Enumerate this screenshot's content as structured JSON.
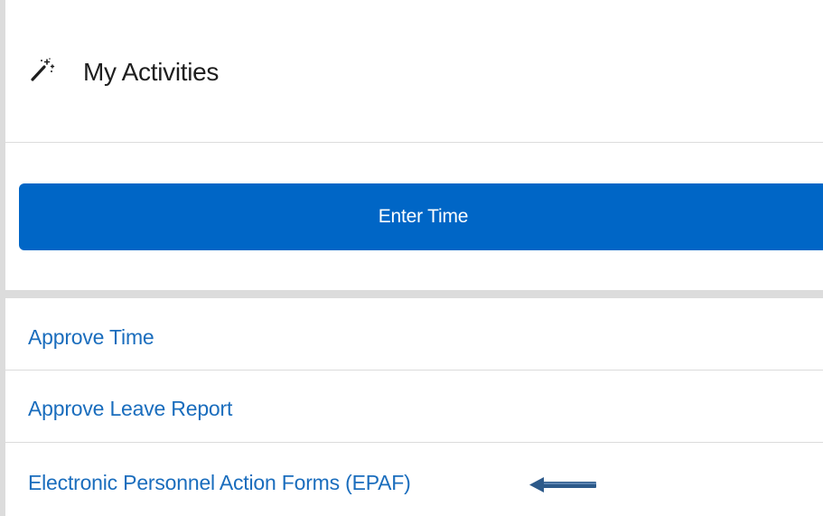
{
  "header": {
    "title": "My Activities",
    "icon": "magic-wand-icon"
  },
  "primary_action": {
    "label": "Enter Time",
    "color": "#0066c6"
  },
  "activities": [
    {
      "label": "Approve Time"
    },
    {
      "label": "Approve Leave Report"
    },
    {
      "label": "Electronic Personnel Action Forms (EPAF)"
    }
  ],
  "annotation": {
    "icon": "left-arrow-icon",
    "color": "#2d5a8a"
  },
  "colors": {
    "link": "#1a6dbd",
    "divider": "#dcdcdc"
  }
}
